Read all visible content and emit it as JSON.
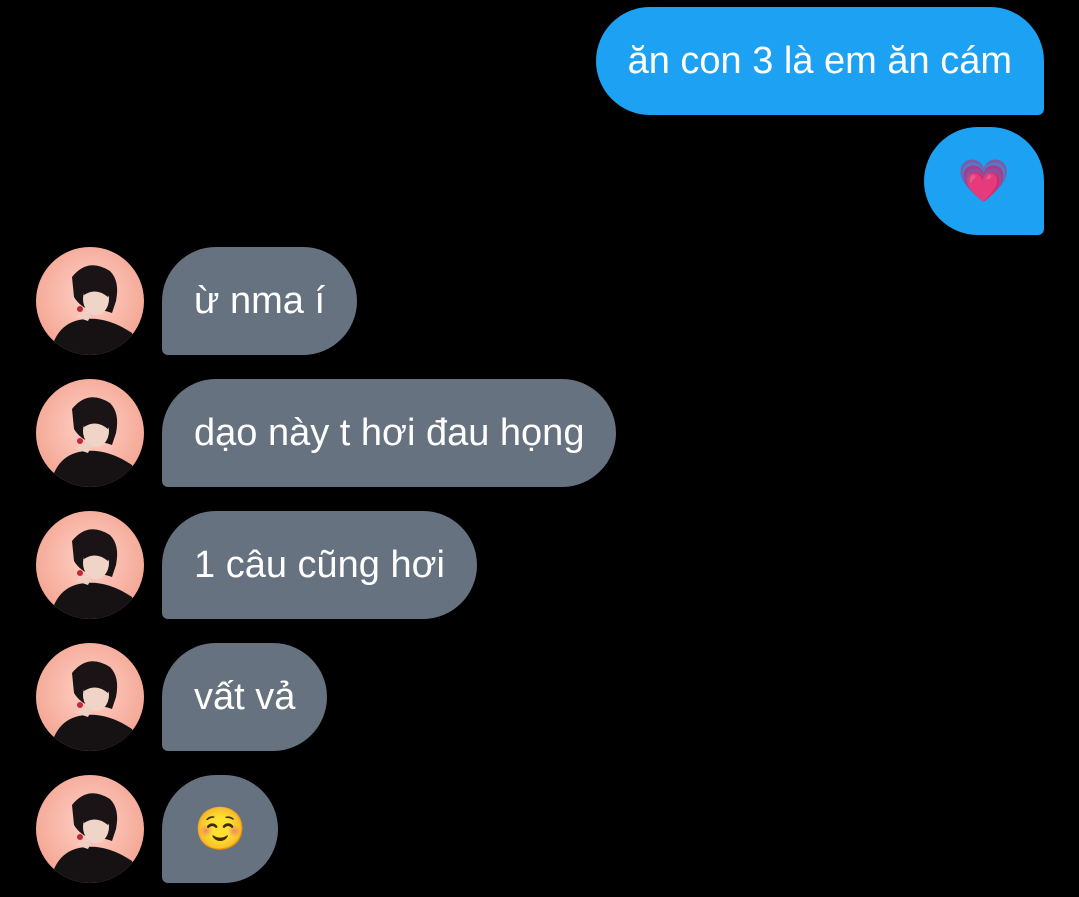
{
  "conversation": {
    "sent": [
      {
        "text": "ăn con 3 là em ăn cám"
      },
      {
        "text": "💗"
      }
    ],
    "received": [
      {
        "text": "ừ nma í"
      },
      {
        "text": "dạo này t hơi đau họng"
      },
      {
        "text": "1 câu cũng hơi"
      },
      {
        "text": "vất vả"
      },
      {
        "text": "☺️"
      }
    ]
  },
  "colors": {
    "background": "#000000",
    "sent_bubble": "#1da1f2",
    "received_bubble": "#66727f",
    "text": "#ffffff"
  }
}
